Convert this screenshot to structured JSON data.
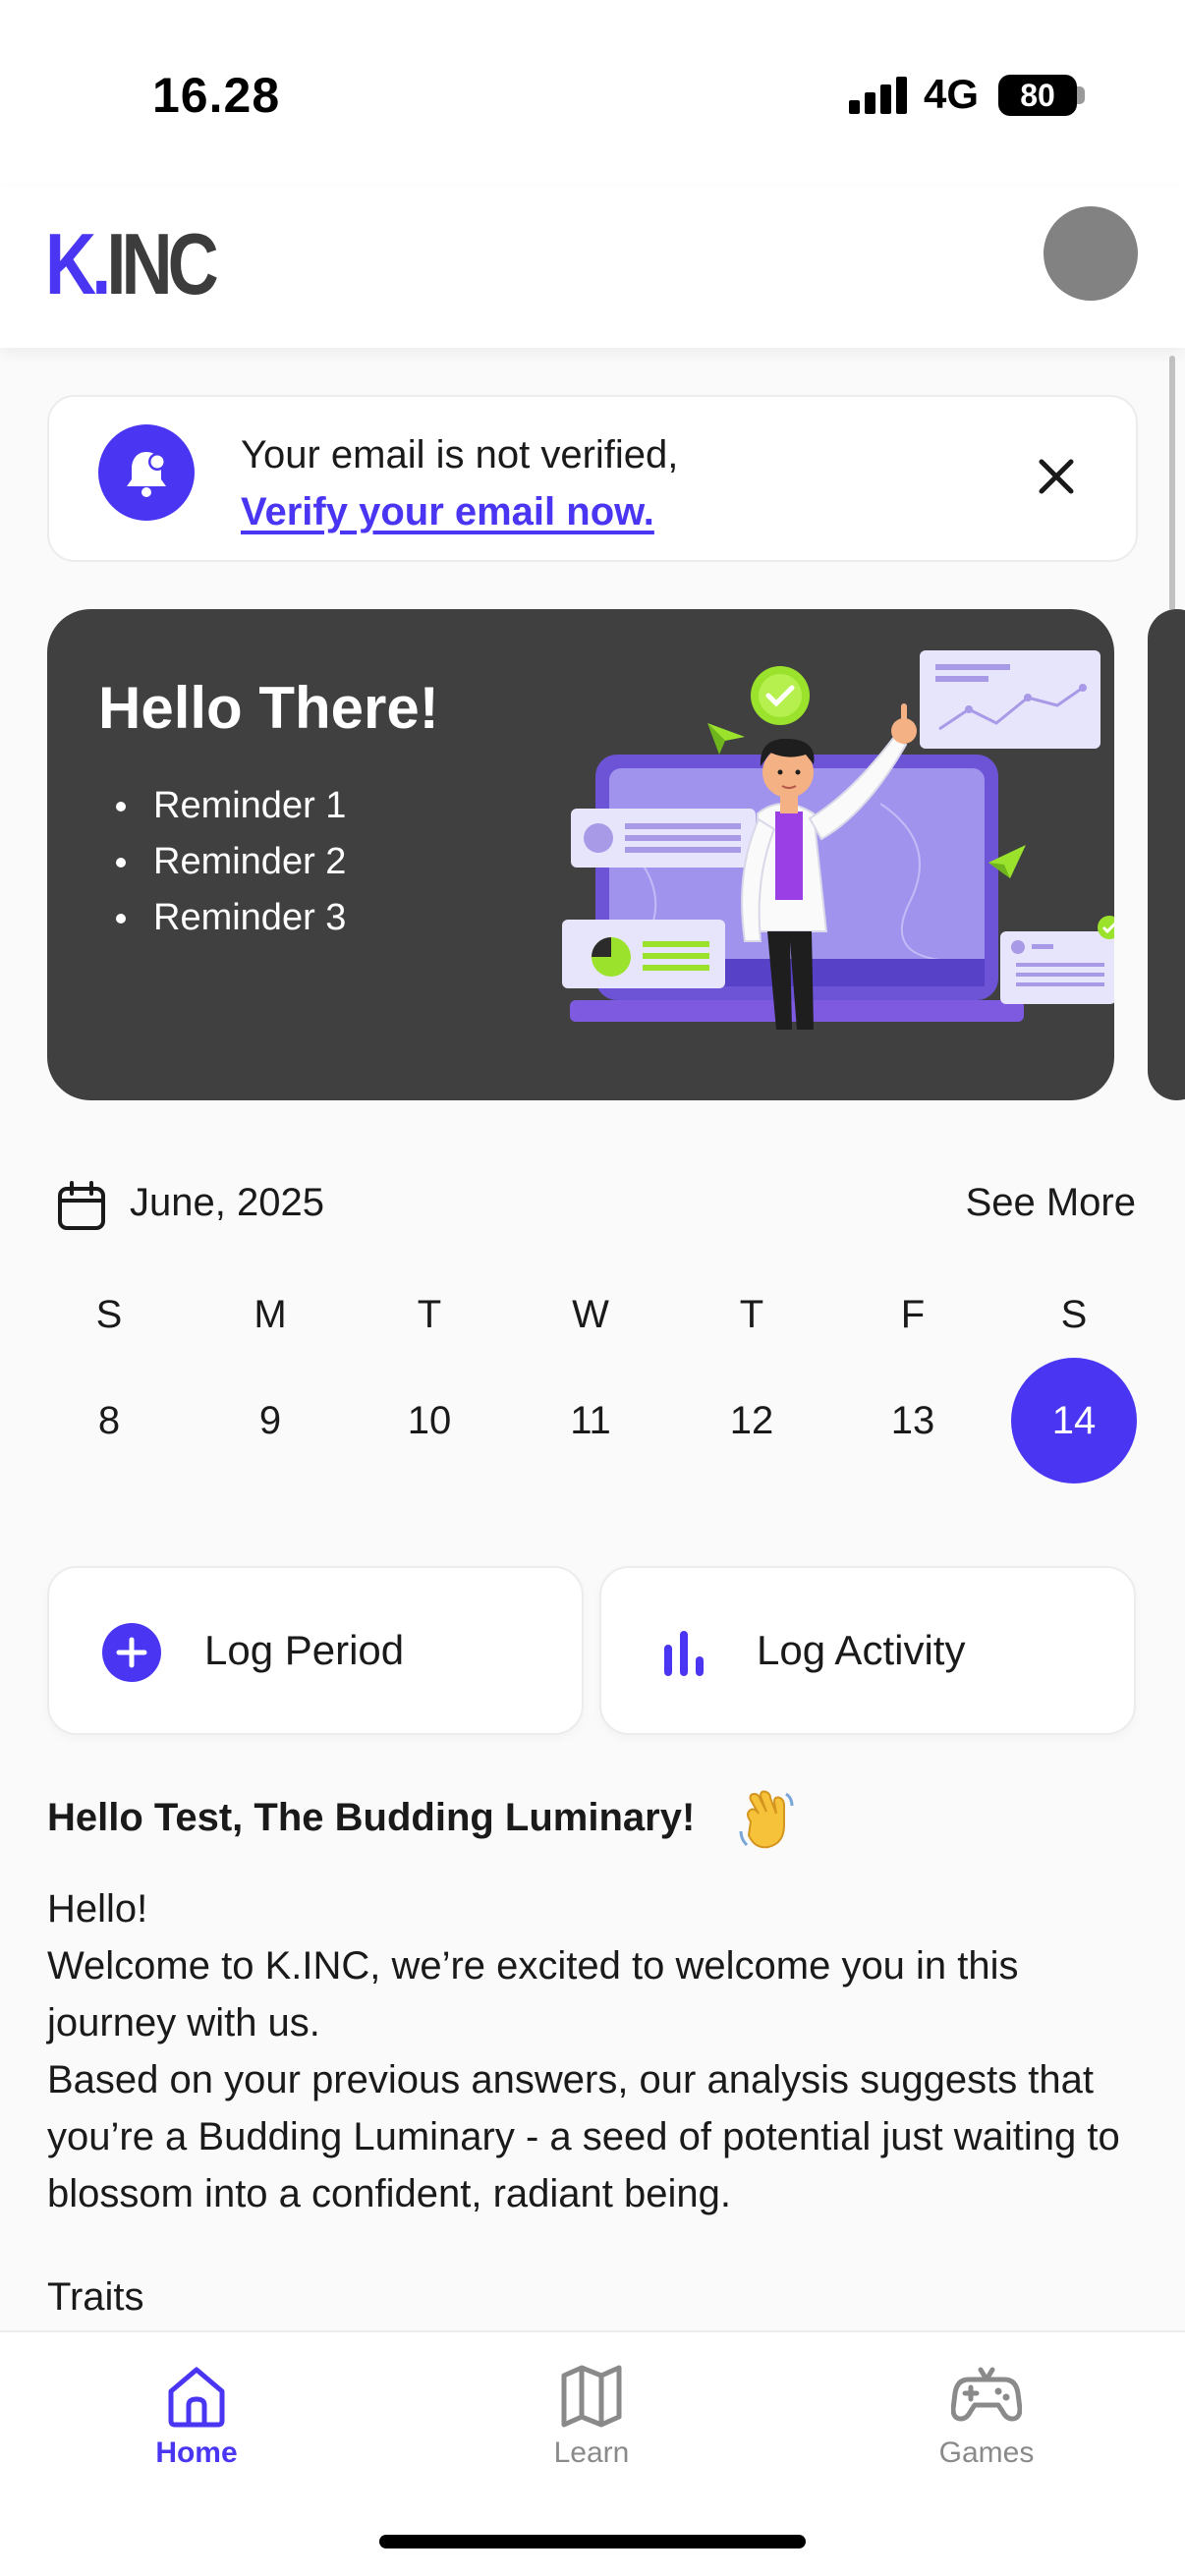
{
  "status_bar": {
    "time": "16.28",
    "network": "4G",
    "battery": "80"
  },
  "header": {
    "logo_k": "K.",
    "logo_rest": "INC",
    "avatar": "profile-avatar"
  },
  "email_banner": {
    "message": "Your email is not verified,",
    "link": "Verify your email now.",
    "icon": "bell-icon",
    "close_icon": "close-icon"
  },
  "hero": {
    "title": "Hello There!",
    "reminders": [
      "Reminder 1",
      "Reminder 2",
      "Reminder 3"
    ]
  },
  "calendar": {
    "month": "June, 2025",
    "see_more": "See More",
    "days": [
      "S",
      "M",
      "T",
      "W",
      "T",
      "F",
      "S"
    ],
    "dates": [
      "8",
      "9",
      "10",
      "11",
      "12",
      "13",
      "14"
    ],
    "selected": "14"
  },
  "actions": {
    "log_period": "Log Period",
    "log_activity": "Log Activity"
  },
  "welcome": {
    "heading": "Hello Test, The Budding Luminary!",
    "greeting": "Hello!",
    "line1": "Welcome to K.INC, we’re excited to welcome you in this journey with us.",
    "line2": "Based on your previous answers, our analysis suggests that you’re a Budding Luminary - a seed of potential just waiting to blossom into a confident, radiant being.",
    "traits": "Traits"
  },
  "nav": {
    "home": "Home",
    "learn": "Learn",
    "games": "Games"
  },
  "colors": {
    "accent": "#4a36f2",
    "card": "#404040",
    "lime": "#9be22d"
  }
}
